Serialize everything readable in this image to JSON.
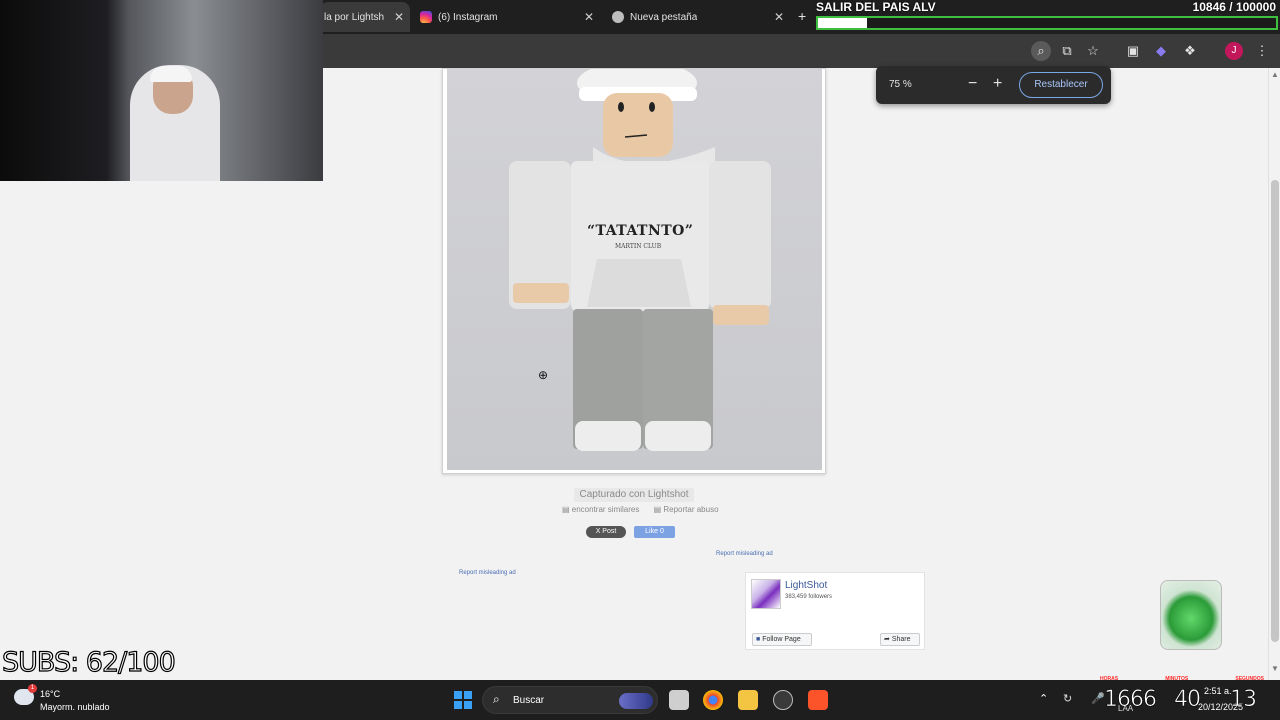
{
  "tabs": [
    {
      "label": "la por Lightsh",
      "close": "✕"
    },
    {
      "label": "(6) Instagram",
      "close": "✕"
    },
    {
      "label": "Nueva pestaña",
      "close": "✕"
    }
  ],
  "new_tab": "+",
  "goal": {
    "title": "SALIR DEL PAIS ALV",
    "count": "10846 / 100000",
    "progress": 0.108
  },
  "zoom": {
    "level": "75 %",
    "minus": "−",
    "plus": "+",
    "reset": "Restablecer"
  },
  "profile_initial": "J",
  "page": {
    "hoodie_text": "“TATATNTO”",
    "hoodie_sub": "MARTIN CLUB",
    "caption": "Capturado con Lightshot",
    "find_similar": "encontrar similares",
    "report_abuse": "Reportar abuso",
    "post": "X Post",
    "like": "Like 0",
    "misleading_1": "Report misleading ad",
    "misleading_2": "Report misleading ad"
  },
  "fb": {
    "name": "LightShot",
    "followers": "383,459 followers",
    "follow": "Follow Page",
    "share": "Share"
  },
  "subs": "SUBS: 62/100",
  "taskbar": {
    "weather_badge": "1",
    "temp": "16°C",
    "desc": "Mayorm. nublado",
    "search": "Buscar",
    "overlay_1": "1666",
    "overlay_2": "40",
    "overlay_3": "13",
    "time": "2:51 a.",
    "date": "20/12/2025",
    "lang": "LAA"
  },
  "red_labels": [
    "HORAS",
    "MINUTOS",
    "SEGUNDOS"
  ]
}
